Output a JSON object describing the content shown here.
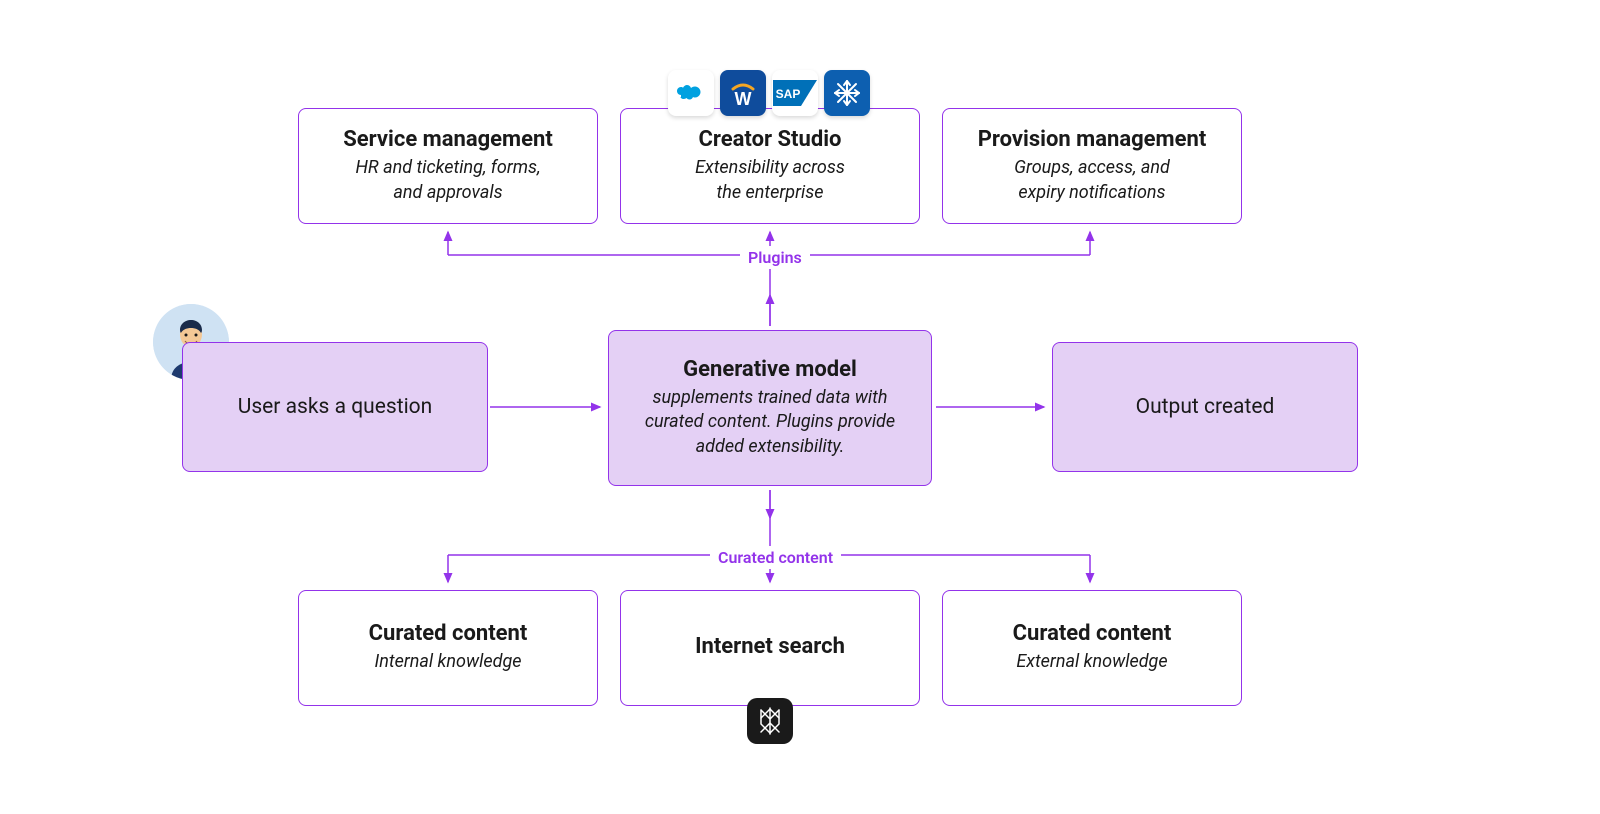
{
  "colors": {
    "purple": "#9333ea",
    "lightPurple": "#e4d0f5",
    "text": "#1a1a1a"
  },
  "topRow": {
    "service": {
      "title": "Service management",
      "subtitle": "HR and ticketing, forms,\nand approvals"
    },
    "creator": {
      "title": "Creator Studio",
      "subtitle": "Extensibility across\nthe enterprise"
    },
    "provision": {
      "title": "Provision management",
      "subtitle": "Groups, access, and\nexpiry notifications"
    }
  },
  "midRow": {
    "user": {
      "text": "User asks a question"
    },
    "model": {
      "title": "Generative model",
      "subtitle": "supplements trained data with curated content. Plugins provide added extensibility."
    },
    "output": {
      "text": "Output created"
    }
  },
  "bottomRow": {
    "internal": {
      "title": "Curated content",
      "subtitle": "Internal  knowledge"
    },
    "search": {
      "title": "Internet search"
    },
    "external": {
      "title": "Curated content",
      "subtitle": "External knowledge"
    }
  },
  "labels": {
    "plugins": "Plugins",
    "curated": "Curated content"
  },
  "icons": {
    "salesforce": "salesforce-icon",
    "workday": "workday-icon",
    "sap": "sap-icon",
    "snowflake": "snowflake-icon",
    "perplexity": "perplexity-icon"
  }
}
